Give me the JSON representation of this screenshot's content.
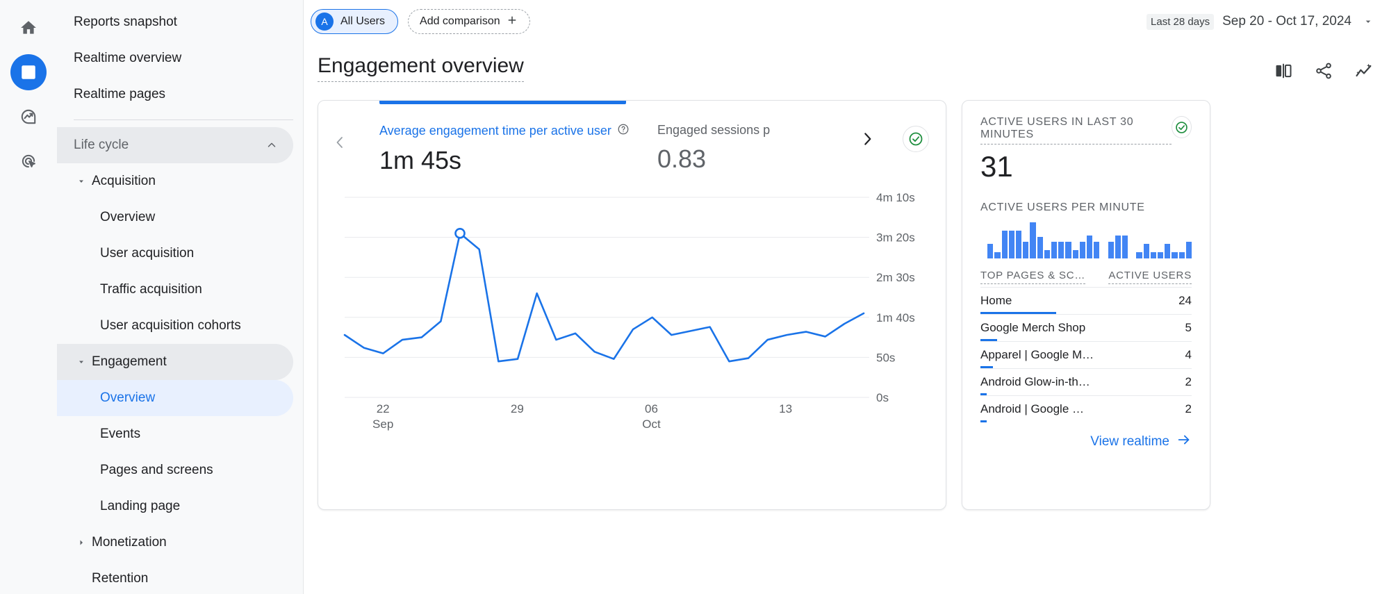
{
  "rail": {
    "items": [
      {
        "name": "home-icon",
        "label": "Home",
        "active": false
      },
      {
        "name": "reports-icon",
        "label": "Reports",
        "active": true
      },
      {
        "name": "explore-icon",
        "label": "Explore",
        "active": false
      },
      {
        "name": "advertising-icon",
        "label": "Advertising",
        "active": false
      }
    ]
  },
  "sidebar": {
    "items": [
      {
        "label": "Reports snapshot",
        "level": 0,
        "state": "normal",
        "caret": "none"
      },
      {
        "label": "Realtime overview",
        "level": 0,
        "state": "normal",
        "caret": "none"
      },
      {
        "label": "Realtime pages",
        "level": 0,
        "state": "normal",
        "caret": "none"
      },
      {
        "label": "Life cycle",
        "level": 0,
        "state": "highlight",
        "caret": "none",
        "group": true,
        "chevron": "up"
      },
      {
        "label": "Acquisition",
        "level": 1,
        "state": "normal",
        "caret": "down"
      },
      {
        "label": "Overview",
        "level": 2,
        "state": "normal",
        "caret": "none"
      },
      {
        "label": "User acquisition",
        "level": 2,
        "state": "normal",
        "caret": "none"
      },
      {
        "label": "Traffic acquisition",
        "level": 2,
        "state": "normal",
        "caret": "none"
      },
      {
        "label": "User acquisition cohorts",
        "level": 2,
        "state": "normal",
        "caret": "none"
      },
      {
        "label": "Engagement",
        "level": 1,
        "state": "highlight",
        "caret": "down"
      },
      {
        "label": "Overview",
        "level": 2,
        "state": "selected",
        "caret": "none"
      },
      {
        "label": "Events",
        "level": 2,
        "state": "normal",
        "caret": "none"
      },
      {
        "label": "Pages and screens",
        "level": 2,
        "state": "normal",
        "caret": "none"
      },
      {
        "label": "Landing page",
        "level": 2,
        "state": "normal",
        "caret": "none"
      },
      {
        "label": "Monetization",
        "level": 1,
        "state": "normal",
        "caret": "right"
      },
      {
        "label": "Retention",
        "level": 1,
        "state": "normal",
        "caret": "none"
      }
    ]
  },
  "topbar": {
    "all_users_avatar": "A",
    "all_users_label": "All Users",
    "add_comparison_label": "Add comparison",
    "add_comparison_plus": "+",
    "date_badge": "Last 28 days",
    "date_range": "Sep 20 - Oct 17, 2024"
  },
  "header": {
    "title": "Engagement overview",
    "actions": [
      "compare-icon",
      "share-icon",
      "insights-icon"
    ]
  },
  "chart_card": {
    "prev_arrow": "‹",
    "next_arrow": "›",
    "metric_primary": {
      "label": "Average engagement time per active user",
      "help": "?",
      "value": "1m 45s"
    },
    "metric_secondary": {
      "label": "Engaged sessions p",
      "value": "0.83"
    },
    "status_icon": "check-circle-icon"
  },
  "chart_data": {
    "type": "line",
    "title": "Average engagement time per active user",
    "xlabel": "",
    "ylabel": "Average engagement time per active user",
    "ytick_labels": [
      "4m 10s",
      "3m 20s",
      "2m 30s",
      "1m 40s",
      "50s",
      "0s"
    ],
    "ytick_values": [
      250,
      200,
      150,
      100,
      50,
      0
    ],
    "ylim": [
      0,
      250
    ],
    "xtick_labels": [
      {
        "top": "22",
        "bottom": "Sep",
        "index": 2
      },
      {
        "top": "29",
        "bottom": "",
        "index": 9
      },
      {
        "top": "06",
        "bottom": "Oct",
        "index": 16
      },
      {
        "top": "13",
        "bottom": "",
        "index": 23
      }
    ],
    "x": [
      "Sep 20",
      "Sep 21",
      "Sep 22",
      "Sep 23",
      "Sep 24",
      "Sep 25",
      "Sep 26",
      "Sep 27",
      "Sep 28",
      "Sep 29",
      "Sep 30",
      "Oct 01",
      "Oct 02",
      "Oct 03",
      "Oct 04",
      "Oct 05",
      "Oct 06",
      "Oct 07",
      "Oct 08",
      "Oct 09",
      "Oct 10",
      "Oct 11",
      "Oct 12",
      "Oct 13",
      "Oct 14",
      "Oct 15",
      "Oct 16",
      "Oct 17"
    ],
    "values": [
      78,
      62,
      55,
      72,
      75,
      95,
      205,
      185,
      45,
      48,
      130,
      72,
      80,
      57,
      48,
      85,
      100,
      78,
      83,
      88,
      45,
      49,
      72,
      78,
      82,
      76,
      92,
      105
    ],
    "series": [
      {
        "name": "Average engagement time per active user",
        "color": "#1a73e8",
        "values": [
          78,
          62,
          55,
          72,
          75,
          95,
          205,
          185,
          45,
          48,
          130,
          72,
          80,
          57,
          48,
          85,
          100,
          78,
          83,
          88,
          45,
          49,
          72,
          78,
          82,
          76,
          92,
          105
        ]
      }
    ],
    "highlight_point": {
      "index": 6,
      "value": 205,
      "label": "1m 45s"
    },
    "grid": true,
    "legend": "none"
  },
  "realtime": {
    "label": "ACTIVE USERS IN LAST 30 MINUTES",
    "value": "31",
    "per_minute_label": "ACTIVE USERS PER MINUTE",
    "status_icon": "check-circle-icon",
    "per_minute_values": [
      0,
      9,
      4,
      17,
      17,
      17,
      10,
      22,
      13,
      5,
      10,
      10,
      10,
      5,
      10,
      14,
      10,
      0,
      10,
      14,
      14,
      0,
      4,
      9,
      4,
      4,
      9,
      4,
      4,
      10
    ],
    "table": {
      "col_dimension": "TOP PAGES & SC…",
      "col_metric": "ACTIVE USERS",
      "rows": [
        {
          "name": "Home",
          "users": "24",
          "bar_pct": 36
        },
        {
          "name": "Google Merch Shop",
          "users": "5",
          "bar_pct": 8
        },
        {
          "name": "Apparel | Google M…",
          "users": "4",
          "bar_pct": 6
        },
        {
          "name": "Android Glow-in-th…",
          "users": "2",
          "bar_pct": 3
        },
        {
          "name": "Android | Google …",
          "users": "2",
          "bar_pct": 3
        }
      ]
    },
    "view_link": "View realtime"
  },
  "colors": {
    "brand_blue": "#1a73e8",
    "chart_blue": "#4285f4",
    "green": "#1e8e3e",
    "sidebar_bg": "#f8f9fa",
    "text": "#202124",
    "muted": "#5f6368"
  }
}
